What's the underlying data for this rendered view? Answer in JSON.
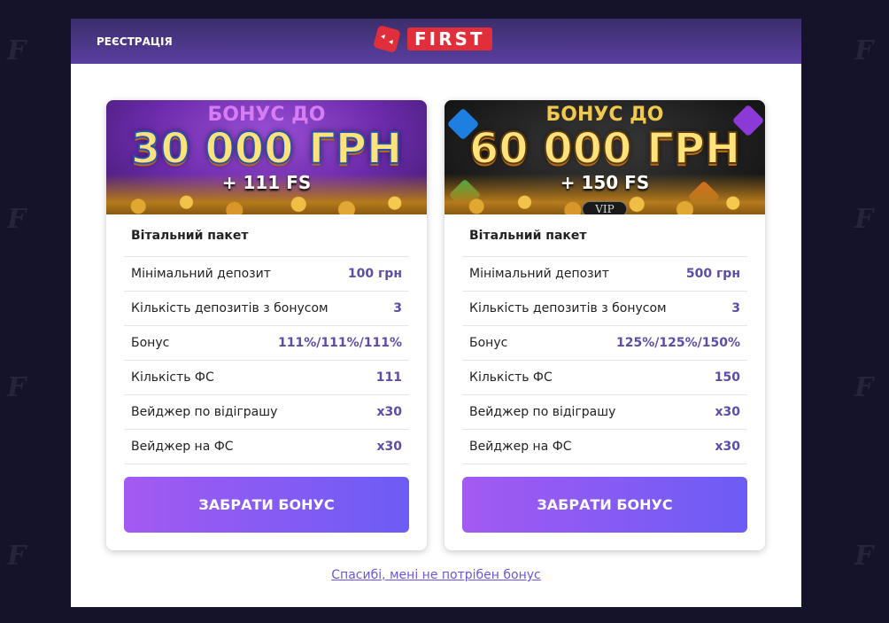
{
  "background_mark": "F",
  "header": {
    "registration_label": "РЕЄСТРАЦІЯ",
    "logo_text": "FIRST",
    "brand_color": "#e02f3a"
  },
  "cards": [
    {
      "banner": {
        "top": "БОНУС ДО",
        "amount": "30 000 ГРН",
        "fs": "+ 111 FS"
      },
      "title": "Вітальний пакет",
      "rows": [
        {
          "label": "Мінімальний депозит",
          "value": "100 грн"
        },
        {
          "label": "Кількість депозитів з бонусом",
          "value": "3"
        },
        {
          "label": "Бонус",
          "value": "111%/111%/111%"
        },
        {
          "label": "Кількість ФС",
          "value": "111"
        },
        {
          "label": "Вейджер по відіграшу",
          "value": "x30"
        },
        {
          "label": "Вейджер на ФС",
          "value": "x30"
        }
      ],
      "button_label": "ЗАБРАТИ БОНУС"
    },
    {
      "banner": {
        "top": "БОНУС ДО",
        "amount": "60 000 ГРН",
        "fs": "+ 150 FS",
        "badge": "VIP"
      },
      "title": "Вітальний пакет",
      "rows": [
        {
          "label": "Мінімальний депозит",
          "value": "500 грн"
        },
        {
          "label": "Кількість депозитів з бонусом",
          "value": "3"
        },
        {
          "label": "Бонус",
          "value": "125%/125%/150%"
        },
        {
          "label": "Кількість ФС",
          "value": "150"
        },
        {
          "label": "Вейджер по відіграшу",
          "value": "x30"
        },
        {
          "label": "Вейджер на ФС",
          "value": "x30"
        }
      ],
      "button_label": "ЗАБРАТИ БОНУС"
    }
  ],
  "decline_link": "Спасибі, мені не потрібен бонус",
  "colors": {
    "accent": "#8b5cf6",
    "value_text": "#5a4ea8",
    "link": "#6a56e3"
  }
}
